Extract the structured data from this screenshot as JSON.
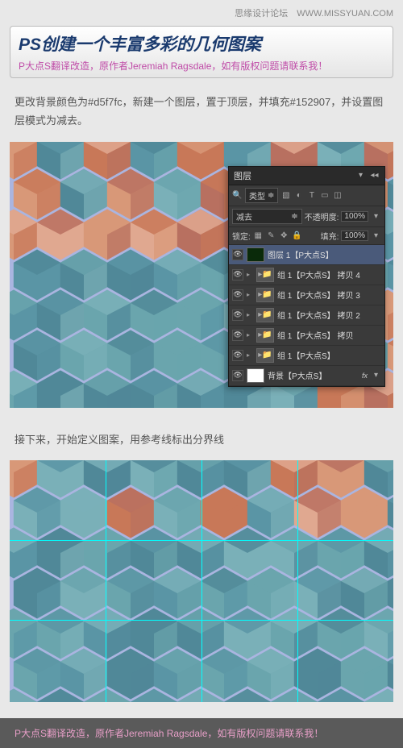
{
  "header": {
    "site": "思缘设计论坛",
    "url": "WWW.MISSYUAN.COM"
  },
  "title": "PS创建一个丰富多彩的几何图案",
  "subtitle": "P大点S翻译改造，原作者Jeremiah Ragsdale，如有版权问题请联系我！",
  "body1": "更改背景颜色为#d5f7fc，新建一个图层，置于顶层，并填充#152907，并设置图层模式为减去。",
  "body2": "接下来，开始定义图案，用参考线标出分界线",
  "footer": "P大点S翻译改造，原作者Jeremiah Ragsdale，如有版权问题请联系我！",
  "panel": {
    "tab": "图层",
    "filterLabel": "类型",
    "blend": "减去",
    "opacityLabel": "不透明度:",
    "opacity": "100%",
    "lockLabel": "锁定:",
    "fillLabel": "填充:",
    "fill": "100%",
    "layers": [
      {
        "name": "图层 1【P大点S】",
        "type": "layer",
        "selected": true
      },
      {
        "name": "组 1【P大点S】 拷贝 4",
        "type": "folder"
      },
      {
        "name": "组 1【P大点S】 拷贝 3",
        "type": "folder"
      },
      {
        "name": "组 1【P大点S】 拷贝 2",
        "type": "folder"
      },
      {
        "name": "组 1【P大点S】 拷贝",
        "type": "folder"
      },
      {
        "name": "组 1【P大点S】",
        "type": "folder"
      },
      {
        "name": "背景【P大点S】",
        "type": "bg",
        "fx": "fx"
      }
    ]
  },
  "colors": {
    "pattern_bg": "#aab5e0",
    "hex_orange": "#d08968",
    "hex_teal": "#6aa5ad",
    "hex_blue": "#5a8aa8"
  }
}
